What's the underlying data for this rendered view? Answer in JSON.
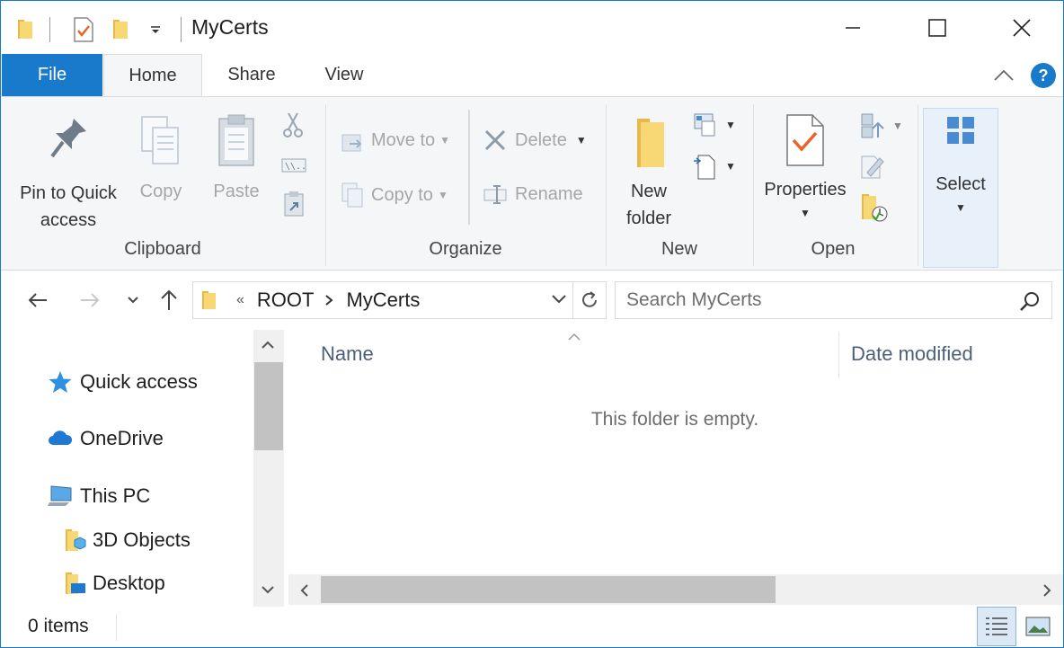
{
  "window": {
    "title": "MyCerts"
  },
  "ribbon_tabs": {
    "file": "File",
    "home": "Home",
    "share": "Share",
    "view": "View",
    "help": "?"
  },
  "clipboard": {
    "pin_line1": "Pin to Quick",
    "pin_line2": "access",
    "copy": "Copy",
    "paste": "Paste",
    "group": "Clipboard"
  },
  "organize": {
    "move_to": "Move to",
    "copy_to": "Copy to",
    "delete": "Delete",
    "rename": "Rename",
    "group": "Organize"
  },
  "new": {
    "new_folder_line1": "New",
    "new_folder_line2": "folder",
    "group": "New"
  },
  "open": {
    "properties": "Properties",
    "group": "Open"
  },
  "select": {
    "label": "Select"
  },
  "address": {
    "overflow": "«",
    "crumbs": [
      "ROOT",
      "MyCerts"
    ]
  },
  "search": {
    "placeholder": "Search MyCerts"
  },
  "nav_pane": {
    "items": [
      {
        "label": "Quick access",
        "icon": "star-icon"
      },
      {
        "label": "OneDrive",
        "icon": "cloud-icon"
      },
      {
        "label": "This PC",
        "icon": "computer-icon"
      },
      {
        "label": "3D Objects",
        "icon": "folder-3d-icon"
      },
      {
        "label": "Desktop",
        "icon": "folder-desktop-icon"
      }
    ]
  },
  "content": {
    "columns": [
      "Name",
      "Date modified"
    ],
    "empty_message": "This folder is empty."
  },
  "status": {
    "items_count": "0 items"
  },
  "colors": {
    "accent": "#1979ca",
    "folder_yellow": "#f8d775",
    "ribbon_bg": "#f5f6f7"
  }
}
